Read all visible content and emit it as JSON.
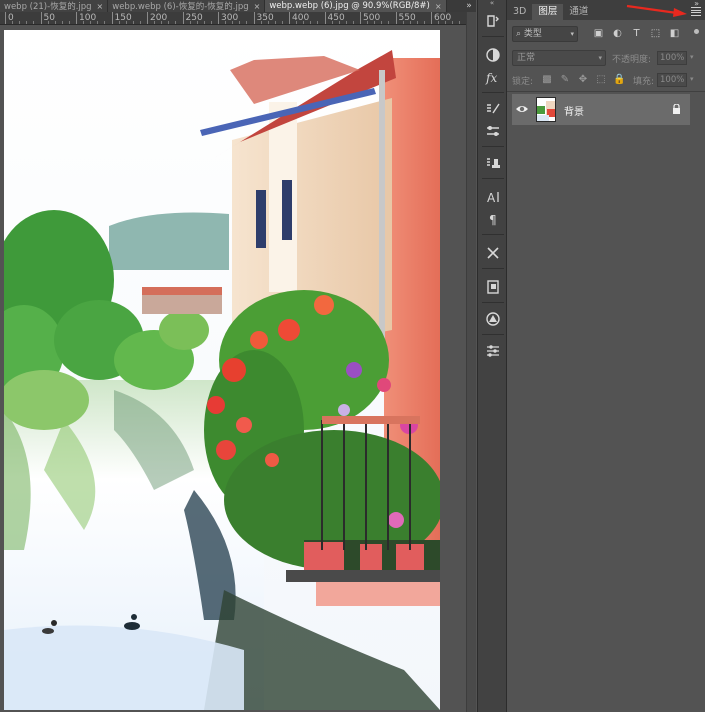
{
  "tabs": [
    {
      "label": "webp (21)-恢复的.jpg",
      "active": false,
      "close": "×"
    },
    {
      "label": "webp.webp (6)-恢复的-恢复的.jpg",
      "active": false,
      "close": "×"
    },
    {
      "label": "webp.webp (6).jpg @ 90.9%(RGB/8#)",
      "active": true,
      "close": "×"
    }
  ],
  "tab_overflow": "»",
  "ruler": {
    "labels": [
      "0",
      "50",
      "100",
      "150",
      "200",
      "250",
      "300",
      "350",
      "400",
      "450",
      "500",
      "550",
      "600"
    ]
  },
  "tools": {
    "collapse": "«",
    "items": [
      "history-brush-icon",
      "adjustment-icon",
      "fx-icon",
      "brush-settings-icon",
      "clone-source-icon",
      "stamp-icon",
      "character-icon",
      "paragraph-icon",
      "tools-preset-icon",
      "properties-icon",
      "adjustments-circle-icon",
      "sliders-icon"
    ]
  },
  "panel": {
    "collapse": "»",
    "tabs": [
      {
        "label": "3D",
        "active": false
      },
      {
        "label": "图层",
        "active": true
      },
      {
        "label": "通道",
        "active": false
      }
    ],
    "arrow_color": "#e8291f",
    "filter": {
      "kind_label": "类型",
      "icons": [
        "T"
      ]
    },
    "blend": {
      "mode": "正常",
      "opacity_label": "不透明度:",
      "opacity_value": "100%"
    },
    "lock": {
      "label": "锁定:",
      "fill_label": "填充:",
      "fill_value": "100%"
    },
    "layers": [
      {
        "name": "背景",
        "visible": true,
        "locked": true
      }
    ]
  },
  "colors": {
    "workspace": "#535353",
    "panel_dark": "#424242",
    "selected_layer": "#6b6b6b"
  }
}
